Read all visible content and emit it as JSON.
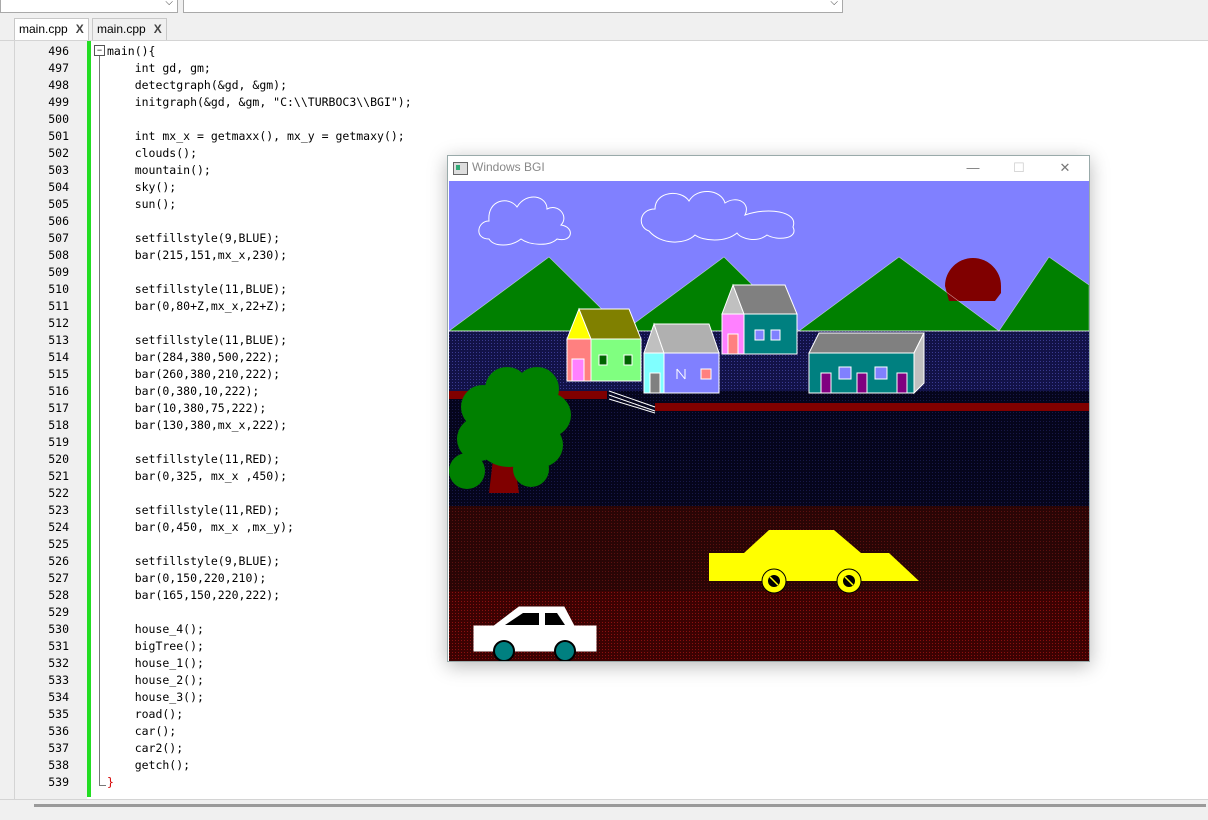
{
  "tabs": [
    {
      "label": "main.cpp",
      "close": "X"
    },
    {
      "label": "main.cpp",
      "close": "X"
    }
  ],
  "editor": {
    "line_numbers": [
      "496",
      "497",
      "498",
      "499",
      "500",
      "501",
      "502",
      "503",
      "504",
      "505",
      "506",
      "507",
      "508",
      "509",
      "510",
      "511",
      "512",
      "513",
      "514",
      "515",
      "516",
      "517",
      "518",
      "519",
      "520",
      "521",
      "522",
      "523",
      "524",
      "525",
      "526",
      "527",
      "528",
      "529",
      "530",
      "531",
      "532",
      "533",
      "534",
      "535",
      "536",
      "537",
      "538",
      "539"
    ],
    "lines": [
      "main(){",
      "    int gd, gm;",
      "    detectgraph(&gd, &gm);",
      "    initgraph(&gd, &gm, \"C:\\\\TURBOC3\\\\BGI\");",
      "",
      "    int mx_x = getmaxx(), mx_y = getmaxy();",
      "    clouds();",
      "    mountain();",
      "    sky();",
      "    sun();",
      "",
      "    setfillstyle(9,BLUE);",
      "    bar(215,151,mx_x,230);",
      "",
      "    setfillstyle(11,BLUE);",
      "    bar(0,80+Z,mx_x,22+Z);",
      "",
      "    setfillstyle(11,BLUE);",
      "    bar(284,380,500,222);",
      "    bar(260,380,210,222);",
      "    bar(0,380,10,222);",
      "    bar(10,380,75,222);",
      "    bar(130,380,mx_x,222);",
      "",
      "    setfillstyle(11,RED);",
      "    bar(0,325, mx_x ,450);",
      "",
      "    setfillstyle(11,RED);",
      "    bar(0,450, mx_x ,mx_y);",
      "",
      "    setfillstyle(9,BLUE);",
      "    bar(0,150,220,210);",
      "    bar(165,150,220,222);",
      "",
      "    house_4();",
      "    bigTree();",
      "    house_1();",
      "    house_2();",
      "    house_3();",
      "    road();",
      "    car();",
      "    car2();",
      "    getch();",
      "}"
    ]
  },
  "bgi_window": {
    "title": "Windows BGI",
    "minimize": "—",
    "maximize": "☐",
    "close": "✕"
  },
  "colors": {
    "sky": "#8080ff",
    "mountain": "#008000",
    "sun": "#800000",
    "car_yellow": "#ffff00",
    "tree_trunk": "#800000",
    "line_green": "#22dd22"
  }
}
